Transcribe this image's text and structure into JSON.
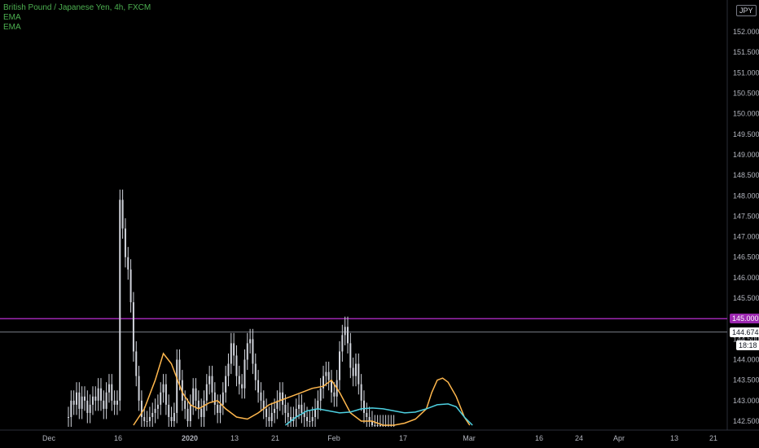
{
  "header": {
    "symbol_title": "British Pound / Japanese Yen, 4h, FXCM",
    "indicators": [
      "EMA",
      "EMA"
    ],
    "title_color": "#4caf50",
    "indicator_color": "#4caf50"
  },
  "currency_badge": "JPY",
  "price_badges": {
    "level_label": "145.000",
    "last_price_label": "144.674",
    "countdown_label": "18:18"
  },
  "colors": {
    "background": "#000000",
    "candles": "#d1d4dc",
    "ema_fast": "#ffb74d",
    "ema_slow": "#4dd0e1",
    "level_line": "#9c27b0",
    "last_price_line": "#787b86",
    "axis_text": "#b2b5be",
    "year_tick": "#4caf50"
  },
  "chart_data": {
    "type": "line",
    "title": "British Pound / Japanese Yen, 4h, FXCM",
    "ylim": [
      142.4,
      152.5
    ],
    "y_ticks": [
      "142.500",
      "143.000",
      "143.500",
      "144.000",
      "144.500",
      "145.000",
      "145.500",
      "146.000",
      "146.500",
      "147.000",
      "147.500",
      "148.000",
      "148.500",
      "149.000",
      "149.500",
      "150.000",
      "150.500",
      "151.000",
      "151.500",
      "152.000"
    ],
    "x_ticks": [
      "Dec",
      "16",
      "2020",
      "13",
      "21",
      "Feb",
      "17",
      "Mar",
      "16",
      "24",
      "Apr",
      "13",
      "21"
    ],
    "horizontal_levels": [
      {
        "name": "level",
        "value": 145.0
      },
      {
        "name": "last_price",
        "value": 144.674
      }
    ],
    "series": [
      {
        "name": "price",
        "style": "candles",
        "x": [
          0,
          1,
          2,
          3,
          4,
          5,
          6,
          7,
          8,
          9,
          10,
          11,
          12,
          13,
          14,
          15,
          16,
          17,
          18,
          19,
          20,
          21,
          22,
          23,
          24,
          25,
          26,
          27,
          28,
          29,
          30,
          31,
          32,
          33,
          34,
          35,
          36,
          37,
          38,
          39,
          40,
          41,
          42,
          43,
          44,
          45,
          46,
          47,
          48,
          49,
          50,
          51,
          52,
          53,
          54,
          55,
          56,
          57,
          58,
          59,
          60,
          61,
          62,
          63,
          64,
          65,
          66,
          67,
          68,
          69,
          70,
          71,
          72,
          73,
          74,
          75,
          76,
          77,
          78,
          79,
          80,
          81,
          82,
          83,
          84,
          85,
          86,
          87,
          88,
          89,
          90,
          91,
          92,
          93,
          94,
          95,
          96,
          97,
          98,
          99,
          100,
          101,
          102,
          103,
          104,
          105,
          106,
          107,
          108,
          109,
          110,
          111,
          112,
          113,
          114,
          115,
          116,
          117,
          118,
          119,
          120
        ],
        "values": [
          142.6,
          143.0,
          142.9,
          143.2,
          142.8,
          143.1,
          143.0,
          142.7,
          142.9,
          143.1,
          143.0,
          143.3,
          143.0,
          142.8,
          143.2,
          143.4,
          143.0,
          142.9,
          143.0,
          147.9,
          147.2,
          146.5,
          146.2,
          145.4,
          144.2,
          143.6,
          143.0,
          142.6,
          142.5,
          142.5,
          142.6,
          142.7,
          142.8,
          142.9,
          143.2,
          143.4,
          142.9,
          142.6,
          142.5,
          142.7,
          144.0,
          143.5,
          143.0,
          142.8,
          142.5,
          142.9,
          143.3,
          143.0,
          142.8,
          142.6,
          143.0,
          143.4,
          143.6,
          143.2,
          142.9,
          142.7,
          142.9,
          143.2,
          143.6,
          143.9,
          144.4,
          144.1,
          143.6,
          143.4,
          143.3,
          144.0,
          144.4,
          144.5,
          143.9,
          143.5,
          143.2,
          143.0,
          142.8,
          142.6,
          142.5,
          142.7,
          142.8,
          143.0,
          143.2,
          142.9,
          142.7,
          142.6,
          142.5,
          142.6,
          142.8,
          142.9,
          142.7,
          142.6,
          142.5,
          142.5,
          142.6,
          142.8,
          143.0,
          143.3,
          143.6,
          143.7,
          143.5,
          143.2,
          143.1,
          143.5,
          144.2,
          144.6,
          144.8,
          144.4,
          143.8,
          143.6,
          143.9,
          143.4,
          143.0,
          142.7,
          142.6,
          142.5,
          142.4,
          142.4,
          142.4,
          142.4,
          142.4,
          142.4,
          142.4,
          142.4,
          142.4
        ]
      },
      {
        "name": "EMA",
        "style": "line",
        "color_key": "ema_fast",
        "points": [
          [
            24,
            142.4
          ],
          [
            28,
            142.8
          ],
          [
            32,
            143.5
          ],
          [
            35,
            144.15
          ],
          [
            38,
            143.9
          ],
          [
            42,
            143.2
          ],
          [
            45,
            142.9
          ],
          [
            48,
            142.8
          ],
          [
            52,
            142.95
          ],
          [
            55,
            143.0
          ],
          [
            58,
            142.8
          ],
          [
            62,
            142.6
          ],
          [
            66,
            142.55
          ],
          [
            70,
            142.7
          ],
          [
            74,
            142.9
          ],
          [
            78,
            143.0
          ],
          [
            82,
            143.1
          ],
          [
            86,
            143.2
          ],
          [
            90,
            143.3
          ],
          [
            94,
            143.35
          ],
          [
            97,
            143.5
          ],
          [
            100,
            143.2
          ],
          [
            104,
            142.7
          ],
          [
            108,
            142.5
          ],
          [
            112,
            142.5
          ],
          [
            116,
            142.4
          ],
          [
            120,
            142.4
          ],
          [
            124,
            142.45
          ],
          [
            128,
            142.55
          ],
          [
            132,
            142.8
          ],
          [
            134,
            143.2
          ],
          [
            136,
            143.5
          ],
          [
            138,
            143.55
          ],
          [
            140,
            143.45
          ],
          [
            143,
            143.1
          ],
          [
            146,
            142.6
          ],
          [
            148,
            142.4
          ]
        ]
      },
      {
        "name": "EMA",
        "style": "line",
        "color_key": "ema_slow",
        "points": [
          [
            80,
            142.4
          ],
          [
            84,
            142.6
          ],
          [
            88,
            142.75
          ],
          [
            92,
            142.8
          ],
          [
            96,
            142.75
          ],
          [
            100,
            142.7
          ],
          [
            104,
            142.72
          ],
          [
            108,
            142.8
          ],
          [
            112,
            142.82
          ],
          [
            116,
            142.8
          ],
          [
            120,
            142.75
          ],
          [
            124,
            142.7
          ],
          [
            128,
            142.72
          ],
          [
            132,
            142.8
          ],
          [
            136,
            142.9
          ],
          [
            140,
            142.92
          ],
          [
            143,
            142.85
          ],
          [
            146,
            142.6
          ],
          [
            149,
            142.4
          ]
        ]
      }
    ]
  }
}
